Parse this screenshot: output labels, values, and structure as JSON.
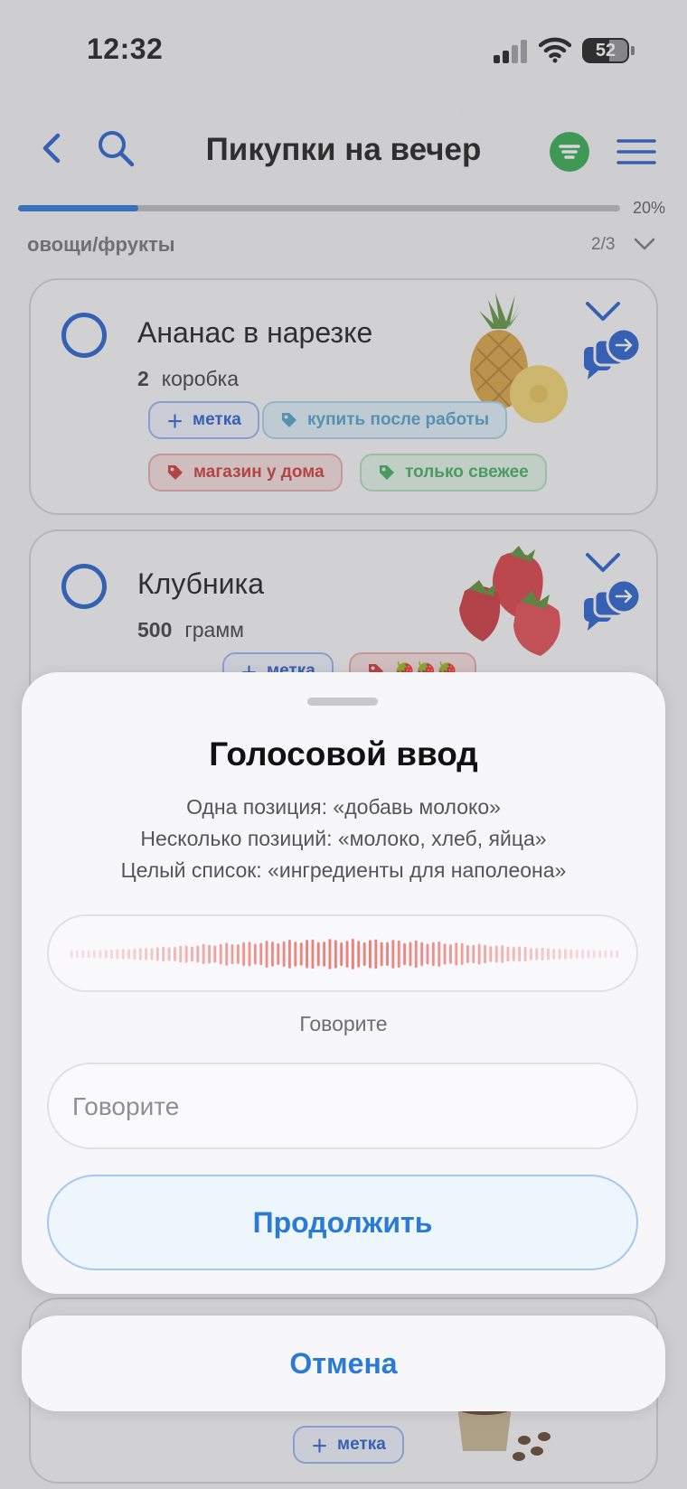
{
  "status_bar": {
    "time": "12:32",
    "battery": "52"
  },
  "nav": {
    "title": "Пикупки на вечер"
  },
  "progress": {
    "value": 0.2,
    "label": "20%"
  },
  "section": {
    "title": "овощи/фрукты",
    "count": "2/3"
  },
  "items": [
    {
      "name": "Ананас в нарезке",
      "qty_value": "2",
      "qty_unit": "коробка",
      "tags": [
        {
          "label": "метка",
          "kind": "add"
        },
        {
          "label": "купить после работы",
          "kind": "blue"
        },
        {
          "label": "магазин у дома",
          "kind": "red"
        },
        {
          "label": "только свежее",
          "kind": "green"
        }
      ]
    },
    {
      "name": "Клубника",
      "qty_value": "500",
      "qty_unit": "грамм",
      "tags": [
        {
          "label": "метка",
          "kind": "add"
        },
        {
          "label": "🍓🍓🍓",
          "kind": "red"
        }
      ]
    },
    {
      "tags": [
        {
          "label": "метка",
          "kind": "add"
        }
      ]
    }
  ],
  "voice_sheet": {
    "title": "Голосовой ввод",
    "hints": [
      "Одна позиция: «добавь молоко»",
      "Несколько позиций: «молоко, хлеб, яйца»",
      "Целый список: «ингредиенты для наполеона»"
    ],
    "status": "Говорите",
    "input_placeholder": "Говорите",
    "continue_label": "Продолжить",
    "wave_color": "#e8605a"
  },
  "cancel_label": "Отмена",
  "colors": {
    "accent": "#1a56c9",
    "filter": "#28a745",
    "action_text": "#2a7ad6"
  }
}
